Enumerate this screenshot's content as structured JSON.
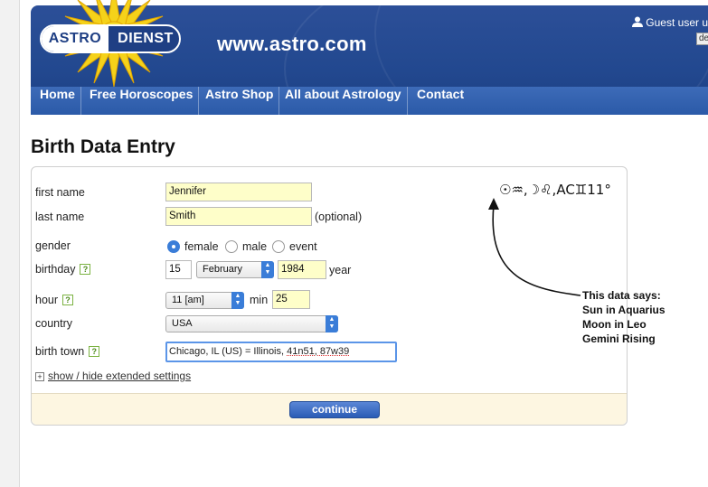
{
  "header": {
    "logo_left": "ASTRO",
    "logo_right": "DIENST",
    "site_name": "www.astro.com",
    "guest_text": "Guest user u",
    "lang_code": "de",
    "brand_color": "#22488f"
  },
  "nav": {
    "items": [
      {
        "label": "Home"
      },
      {
        "label": "Free Horoscopes"
      },
      {
        "label": "Astro Shop"
      },
      {
        "label": "All about Astrology"
      },
      {
        "label": "Contact"
      }
    ]
  },
  "page_title": "Birth Data Entry",
  "form": {
    "first_name_label": "first name",
    "first_name_value": "Jennifer",
    "last_name_label": "last name",
    "last_name_value": "Smith",
    "last_name_note": "(optional)",
    "gender_label": "gender",
    "gender_options": [
      {
        "label": "female",
        "selected": true
      },
      {
        "label": "male",
        "selected": false
      },
      {
        "label": "event",
        "selected": false
      }
    ],
    "birthday_label": "birthday",
    "birth_day": "15",
    "birth_month": "February",
    "birth_year": "1984",
    "year_label": "year",
    "hour_label": "hour",
    "hour_value": "11 [am]",
    "min_label": "min",
    "min_value": "25",
    "country_label": "country",
    "country_value": "USA",
    "birth_town_label": "birth town",
    "birth_town_prefix": "Chicago, IL (US) = Illinois, ",
    "birth_town_coords": "41n51, 87w39",
    "help_glyph": "?",
    "extended_settings_link": "show / hide extended settings",
    "continue_label": "continue"
  },
  "annotation": {
    "symbols": "☉♒,☽♌,AC♊11°",
    "lines": [
      "This data says:",
      "Sun in Aquarius",
      "Moon in Leo",
      "Gemini Rising"
    ]
  }
}
